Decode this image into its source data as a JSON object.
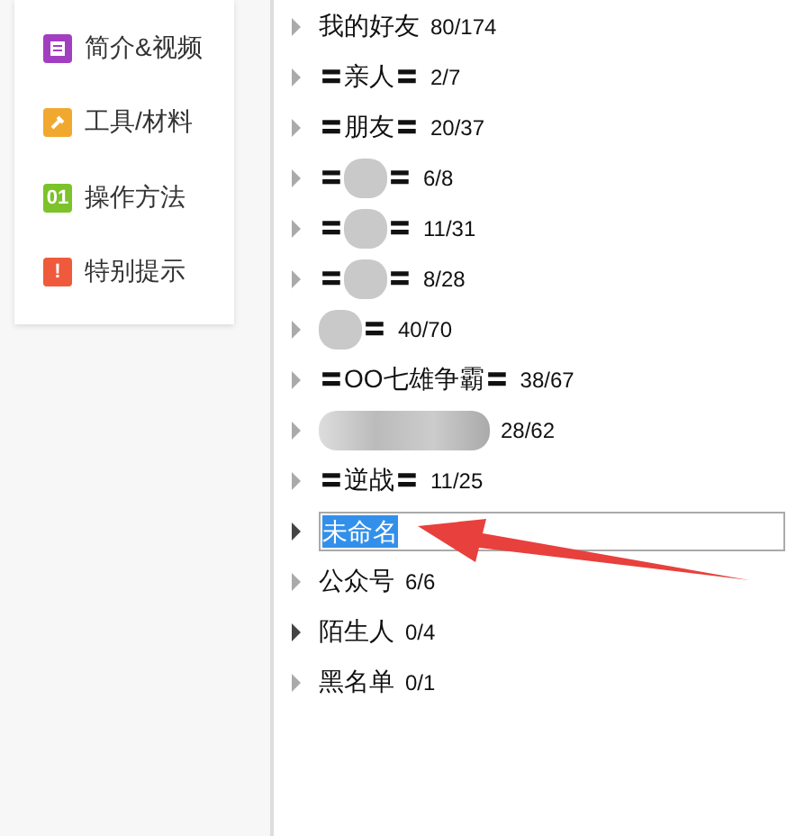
{
  "sidebar": {
    "items": [
      {
        "label": "简介&视频",
        "kind": "list",
        "color": "#a23fc0"
      },
      {
        "label": "工具/材料",
        "kind": "wrench",
        "color": "#f0a92e"
      },
      {
        "label": "操作方法",
        "kind": "number",
        "icon_text": "01",
        "color": "#7cc22a"
      },
      {
        "label": "特别提示",
        "kind": "alert",
        "icon_text": "!",
        "color": "#ef5a3c"
      }
    ]
  },
  "groups": [
    {
      "name": [
        {
          "text": "我的好友"
        }
      ],
      "count": "80/174",
      "dark": false
    },
    {
      "name": [
        {
          "text": "〓亲人〓"
        }
      ],
      "count": "2/7",
      "dark": false
    },
    {
      "name": [
        {
          "text": "〓朋友〓"
        }
      ],
      "count": "20/37",
      "dark": false
    },
    {
      "name": [
        {
          "text": "〓"
        },
        {
          "kind": "blur"
        },
        {
          "text": "〓"
        }
      ],
      "count": "6/8",
      "dark": false
    },
    {
      "name": [
        {
          "text": "〓"
        },
        {
          "kind": "blur"
        },
        {
          "text": "〓"
        }
      ],
      "count": "11/31",
      "dark": false
    },
    {
      "name": [
        {
          "text": "〓"
        },
        {
          "kind": "blur"
        },
        {
          "text": "〓"
        }
      ],
      "count": "8/28",
      "dark": false
    },
    {
      "name": [
        {
          "kind": "blur"
        },
        {
          "text": "〓"
        }
      ],
      "count": "40/70",
      "dark": false
    },
    {
      "name": [
        {
          "text": "〓OO七雄争霸〓"
        }
      ],
      "count": "38/67",
      "dark": false
    },
    {
      "name": [
        {
          "kind": "blur_wide"
        }
      ],
      "count": "28/62",
      "dark": false
    },
    {
      "name": [
        {
          "text": "〓逆战〓"
        }
      ],
      "count": "11/25",
      "dark": false
    },
    {
      "kind": "editing",
      "value": "未命名",
      "dark": true
    },
    {
      "name": [
        {
          "text": "公众号"
        }
      ],
      "count": "6/6",
      "dark": false
    },
    {
      "name": [
        {
          "text": "陌生人"
        }
      ],
      "count": "0/4",
      "dark": true
    },
    {
      "name": [
        {
          "text": "黑名单"
        }
      ],
      "count": "0/1",
      "dark": false
    }
  ]
}
